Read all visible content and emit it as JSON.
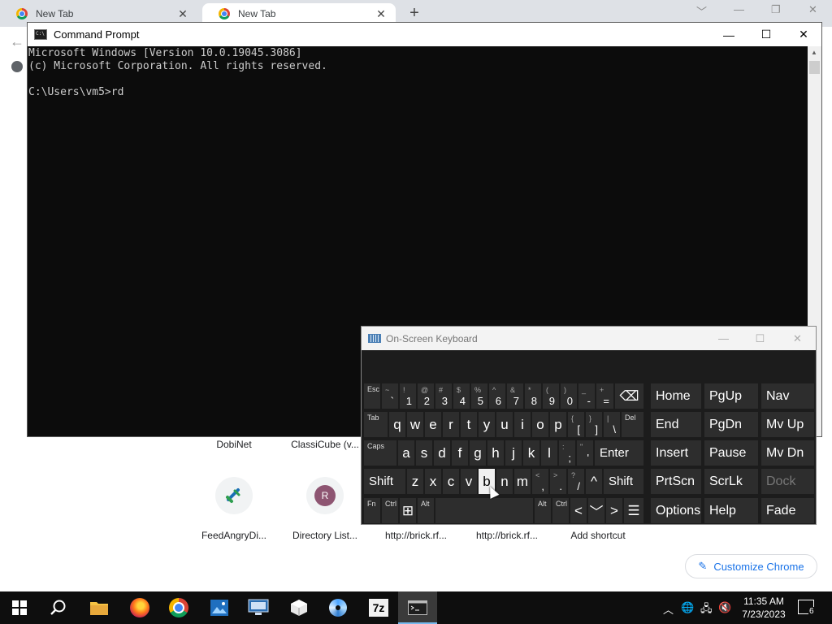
{
  "chrome": {
    "tabs": [
      {
        "title": "New Tab"
      },
      {
        "title": "New Tab"
      }
    ],
    "shortcuts_row1": [
      "DobiNet",
      "ClassiCube (v..."
    ],
    "shortcuts_row2": [
      {
        "label": "FeedAngryDi...",
        "icon": "link-arrows-icon"
      },
      {
        "label": "Directory List...",
        "icon_letter": "R"
      },
      {
        "label": "http://brick.rf..."
      },
      {
        "label": "http://brick.rf..."
      },
      {
        "label": "Add shortcut"
      }
    ],
    "customize_label": "Customize Chrome"
  },
  "cmd": {
    "title": "Command Prompt",
    "console_text": "Microsoft Windows [Version 10.0.19045.3086]\n(c) Microsoft Corporation. All rights reserved.\n\nC:\\Users\\vm5>rd"
  },
  "osk": {
    "title": "On-Screen Keyboard",
    "row1": [
      {
        "id": "esc",
        "sm": "Esc"
      },
      {
        "id": "backtick",
        "sh": "~",
        "mn": "`"
      },
      {
        "id": "1",
        "sh": "!",
        "mn": "1"
      },
      {
        "id": "2",
        "sh": "@",
        "mn": "2"
      },
      {
        "id": "3",
        "sh": "#",
        "mn": "3"
      },
      {
        "id": "4",
        "sh": "$",
        "mn": "4"
      },
      {
        "id": "5",
        "sh": "%",
        "mn": "5"
      },
      {
        "id": "6",
        "sh": "^",
        "mn": "6"
      },
      {
        "id": "7",
        "sh": "&",
        "mn": "7"
      },
      {
        "id": "8",
        "sh": "*",
        "mn": "8"
      },
      {
        "id": "9",
        "sh": "(",
        "mn": "9"
      },
      {
        "id": "0",
        "sh": ")",
        "mn": "0"
      },
      {
        "id": "minus",
        "sh": "_",
        "mn": "-"
      },
      {
        "id": "equals",
        "sh": "+",
        "mn": "="
      },
      {
        "id": "backspace",
        "label": "⌫"
      }
    ],
    "row2": [
      {
        "id": "tab",
        "sm": "Tab"
      },
      {
        "id": "q",
        "label": "q"
      },
      {
        "id": "w",
        "label": "w"
      },
      {
        "id": "e",
        "label": "e"
      },
      {
        "id": "r",
        "label": "r"
      },
      {
        "id": "t",
        "label": "t"
      },
      {
        "id": "y",
        "label": "y"
      },
      {
        "id": "u",
        "label": "u"
      },
      {
        "id": "i",
        "label": "i"
      },
      {
        "id": "o",
        "label": "o"
      },
      {
        "id": "p",
        "label": "p"
      },
      {
        "id": "lbracket",
        "sh": "{",
        "mn": "["
      },
      {
        "id": "rbracket",
        "sh": "}",
        "mn": "]"
      },
      {
        "id": "backslash",
        "sh": "|",
        "mn": "\\"
      },
      {
        "id": "del",
        "sm": "Del"
      }
    ],
    "row3": [
      {
        "id": "caps",
        "sm": "Caps"
      },
      {
        "id": "a",
        "label": "a"
      },
      {
        "id": "s",
        "label": "s"
      },
      {
        "id": "d",
        "label": "d"
      },
      {
        "id": "f",
        "label": "f"
      },
      {
        "id": "g",
        "label": "g"
      },
      {
        "id": "h",
        "label": "h"
      },
      {
        "id": "j",
        "label": "j"
      },
      {
        "id": "k",
        "label": "k"
      },
      {
        "id": "l",
        "label": "l"
      },
      {
        "id": "semicolon",
        "sh": ":",
        "mn": ";"
      },
      {
        "id": "quote",
        "sh": "\"",
        "mn": "'"
      },
      {
        "id": "enter",
        "label": "Enter"
      }
    ],
    "row4": [
      {
        "id": "lshift",
        "label": "Shift"
      },
      {
        "id": "z",
        "label": "z"
      },
      {
        "id": "x",
        "label": "x"
      },
      {
        "id": "c",
        "label": "c"
      },
      {
        "id": "v",
        "label": "v"
      },
      {
        "id": "b",
        "label": "b",
        "pressed": true
      },
      {
        "id": "n",
        "label": "n"
      },
      {
        "id": "m",
        "label": "m"
      },
      {
        "id": "comma",
        "sh": "<",
        "mn": ","
      },
      {
        "id": "period",
        "sh": ">",
        "mn": "."
      },
      {
        "id": "slash",
        "sh": "?",
        "mn": "/"
      },
      {
        "id": "uparrow",
        "label": "^"
      },
      {
        "id": "rshift",
        "label": "Shift"
      }
    ],
    "row5": [
      {
        "id": "fn",
        "sm": "Fn"
      },
      {
        "id": "ctrl-left",
        "sm": "Ctrl"
      },
      {
        "id": "win",
        "label": "⊞"
      },
      {
        "id": "alt-left",
        "sm": "Alt"
      },
      {
        "id": "space",
        "label": ""
      },
      {
        "id": "alt-right",
        "sm": "Alt"
      },
      {
        "id": "ctrl-right",
        "sm": "Ctrl"
      },
      {
        "id": "left",
        "label": "<"
      },
      {
        "id": "down",
        "label": "﹀"
      },
      {
        "id": "right",
        "label": ">"
      },
      {
        "id": "menu",
        "label": "☰"
      }
    ],
    "nav": [
      {
        "id": "home",
        "label": "Home"
      },
      {
        "id": "pgup",
        "label": "PgUp"
      },
      {
        "id": "navk",
        "label": "Nav"
      },
      {
        "id": "end",
        "label": "End"
      },
      {
        "id": "pgdn",
        "label": "PgDn"
      },
      {
        "id": "mvup",
        "label": "Mv Up"
      },
      {
        "id": "insert",
        "label": "Insert"
      },
      {
        "id": "pause",
        "label": "Pause"
      },
      {
        "id": "mvdn",
        "label": "Mv Dn"
      },
      {
        "id": "prtscn",
        "label": "PrtScn"
      },
      {
        "id": "scrlk",
        "label": "ScrLk"
      },
      {
        "id": "dock",
        "label": "Dock",
        "disabled": true
      },
      {
        "id": "options",
        "label": "Options"
      },
      {
        "id": "help",
        "label": "Help"
      },
      {
        "id": "fade",
        "label": "Fade"
      }
    ]
  },
  "taskbar": {
    "items": [
      "start-icon",
      "search-icon",
      "file-explorer-icon",
      "firefox-icon",
      "chrome-icon",
      "photos-icon",
      "remote-desktop-icon",
      "package-icon",
      "media-disc-icon",
      "7zip-icon",
      "command-prompt-icon"
    ],
    "time": "11:35 AM",
    "date": "7/23/2023",
    "notification_count": "6",
    "seven_zip_label": "7z"
  },
  "colors": {
    "console_bg": "#0c0c0c",
    "console_fg": "#cccccc",
    "osk_bg": "#1c1c1c",
    "osk_key": "#2d2d2d",
    "accent": "#1a73e8",
    "taskbar": "#0e0e0e"
  }
}
